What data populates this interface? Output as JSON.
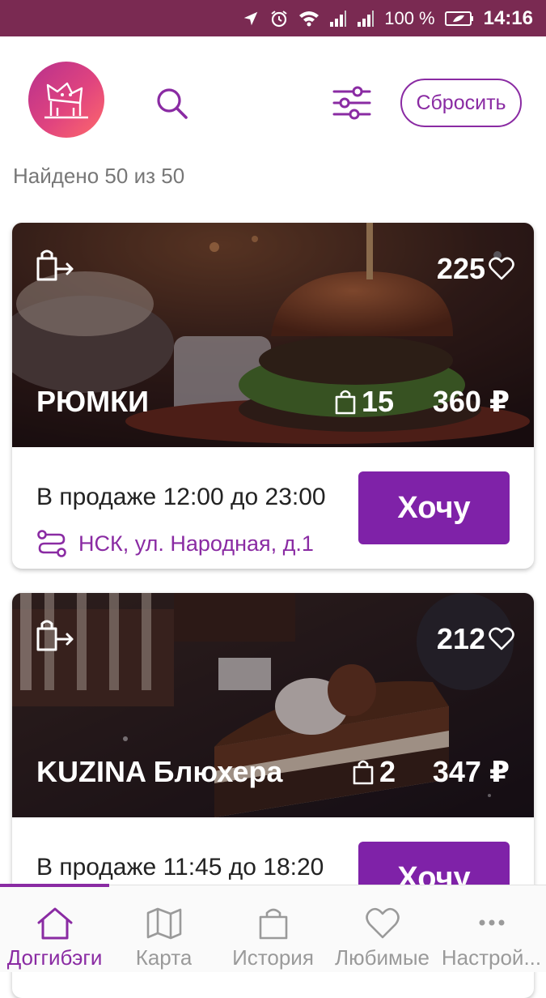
{
  "status_bar": {
    "battery": "100 %",
    "time": "14:16",
    "icons": [
      "location-arrow-icon",
      "alarm-icon",
      "wifi-icon",
      "signal-icon",
      "signal-icon",
      "battery-icon"
    ]
  },
  "header": {
    "reset_label": "Сбросить",
    "found_text": "Найдено 50 из 50"
  },
  "cards": [
    {
      "title": "РЮМКИ",
      "likes": "225",
      "quantity": "15",
      "price": "360 ₽",
      "sale_text": "В продаже 12:00 до 23:00",
      "address": "НСК, ул. Народная,  д.1",
      "button_label": "Хочу"
    },
    {
      "title": "KUZINA Блюхера",
      "likes": "212",
      "quantity": "2",
      "price": "347 ₽",
      "sale_text": "В продаже 11:45 до 18:20",
      "button_label": "Хочу"
    }
  ],
  "bottom_nav": [
    {
      "label": "Доггибэги",
      "icon": "home-icon",
      "active": true
    },
    {
      "label": "Карта",
      "icon": "map-icon",
      "active": false
    },
    {
      "label": "История",
      "icon": "bag-icon",
      "active": false
    },
    {
      "label": "Любимые",
      "icon": "heart-icon",
      "active": false
    },
    {
      "label": "Настрой...",
      "icon": "more-icon",
      "active": false
    }
  ],
  "colors": {
    "accent": "#8a2ba3",
    "button": "#7f22a8",
    "status_bar": "#7a2a52"
  }
}
